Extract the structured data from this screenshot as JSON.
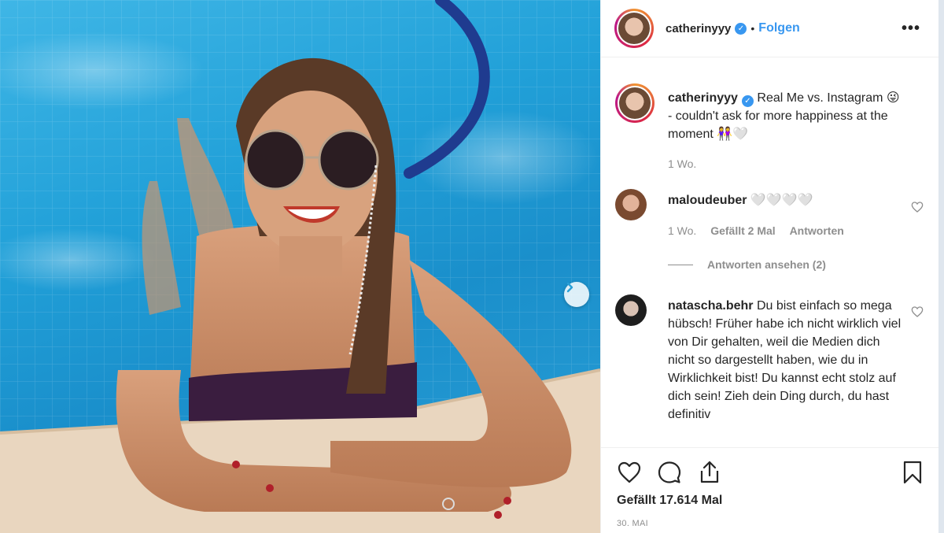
{
  "post": {
    "author": "catherinyyy",
    "follow_label": "Folgen",
    "separator": "•",
    "more_label": "•••"
  },
  "caption": {
    "username": "catherinyyy",
    "text": "Real Me vs. Instagram 😜 - couldn't ask for more happiness at the moment 👭🤍",
    "time": "1 Wo."
  },
  "comments": [
    {
      "username": "maloudeuber",
      "text": "🤍🤍🤍🤍",
      "time": "1 Wo.",
      "likes": "Gefällt 2 Mal",
      "reply_label": "Antworten",
      "view_replies": "Antworten ansehen (2)"
    },
    {
      "username": "natascha.behr",
      "text": "Du bist einfach so mega hübsch! Früher habe ich nicht wirklich viel von Dir gehalten, weil die Medien dich nicht so dargestellt haben, wie du in Wirklichkeit bist! Du kannst echt stolz auf dich sein! Zieh dein Ding durch, du hast definitiv"
    }
  ],
  "footer": {
    "likes": "Gefällt 17.614 Mal",
    "date": "30. MAI"
  },
  "icons": {
    "like": "heart-icon",
    "comment": "comment-icon",
    "share": "share-icon",
    "save": "bookmark-icon",
    "next": "chevron-right-icon"
  },
  "colors": {
    "link": "#3897f0",
    "verified": "#3897f0",
    "muted": "#8e8e8e",
    "text": "#262626"
  }
}
